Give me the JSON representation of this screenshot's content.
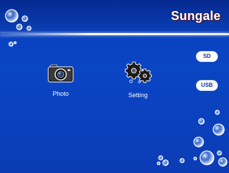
{
  "header": {
    "brand": "Sungale"
  },
  "menu": [
    {
      "label": "Photo",
      "icon": "camera-icon"
    },
    {
      "label": "Setting",
      "icon": "gears-icon"
    }
  ],
  "storage": [
    {
      "label": "SD"
    },
    {
      "label": "USB"
    }
  ],
  "colors": {
    "background": "#0a40bd",
    "header_band": "#062a8f",
    "brand_text": "#ffffff",
    "pill_background": "#ffffff",
    "pill_text": "#0a3aa8"
  }
}
